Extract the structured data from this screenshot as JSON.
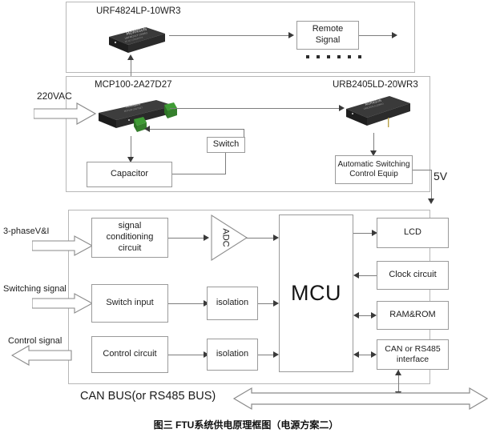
{
  "figure": {
    "caption": "图三  FTU系统供电原理框图（电源方案二）"
  },
  "panel_top": {
    "part_number": "URF4824LP-10WR3",
    "module_brand": "MORNSUN",
    "remote_signal_label": "Remote Signal",
    "continuation_dots_count": 6
  },
  "panel_middle": {
    "input_label": "220VAC",
    "left_part_number": "MCP100-2A27D27",
    "right_part_number": "URB2405LD-20WR3",
    "module_brand": "MORNSUN",
    "switch_label": "Switch",
    "capacitor_label": "Capacitor",
    "auto_switch_label_line1": "Automatic Switching",
    "auto_switch_label_line2": "Control  Equip",
    "output_voltage_label": "5V"
  },
  "panel_bottom": {
    "inputs": [
      {
        "label": "3-phaseV&I"
      },
      {
        "label": "Switching signal"
      },
      {
        "label": "Control signal"
      }
    ],
    "left_blocks": [
      {
        "label": "signal conditioning circuit"
      },
      {
        "label": "Switch input"
      },
      {
        "label": "Control circuit"
      }
    ],
    "middle_blocks": [
      {
        "label": "ADC"
      },
      {
        "label": "isolation"
      },
      {
        "label": "isolation"
      }
    ],
    "mcu_label": "MCU",
    "right_blocks": [
      {
        "label": "LCD"
      },
      {
        "label": "Clock circuit"
      },
      {
        "label": "RAM&ROM"
      },
      {
        "label": "CAN or RS485 interface"
      }
    ]
  },
  "bus": {
    "label": "CAN BUS(or RS485 BUS)"
  },
  "colors": {
    "panel_border": "#b7b7b7",
    "box_border": "#9a9a9a",
    "line": "#7d7d7d",
    "text": "#202020",
    "module_body": "#2a2a2a",
    "module_terminal": "#3f9c35"
  }
}
